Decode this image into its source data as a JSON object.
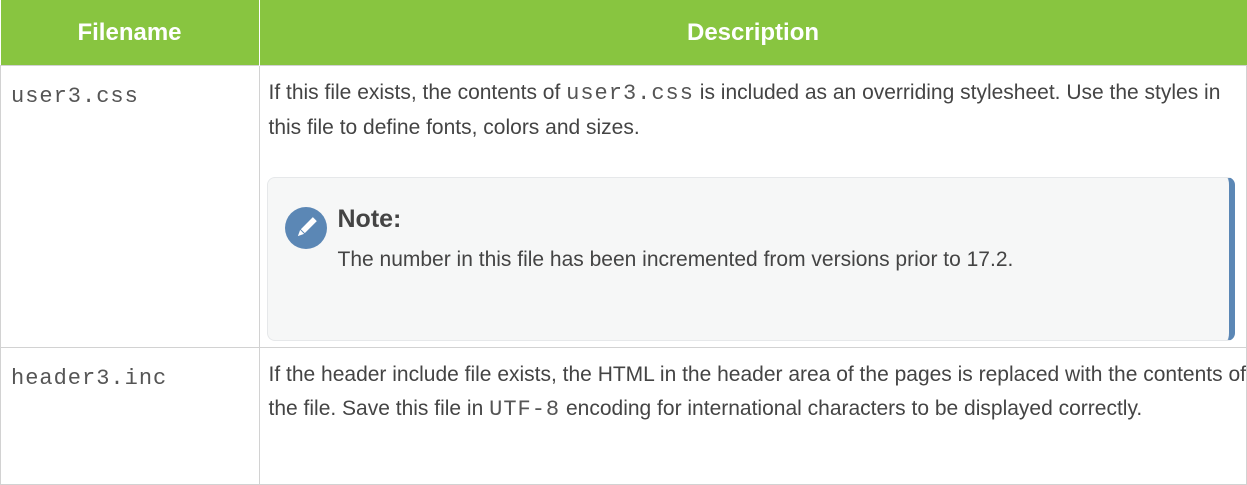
{
  "table": {
    "headers": {
      "filename": "Filename",
      "description": "Description"
    },
    "rows": [
      {
        "filename": "user3.css",
        "desc_part1": "If this file exists, the contents of ",
        "desc_code": "user3.css",
        "desc_part2": " is included as an overriding stylesheet. Use the styles in this file to define fonts, colors and sizes.",
        "note": {
          "icon": "pencil-icon",
          "title": "Note:",
          "body": "The number in this file has been incremented from versions prior to 17.2."
        }
      },
      {
        "filename": "header3.inc",
        "desc_part1": "If the header include file exists, the HTML in the header area of the pages is replaced with the contents of the file. Save this file in ",
        "desc_code": "UTF-8",
        "desc_part2": " encoding for international characters to be displayed correctly."
      }
    ]
  },
  "colors": {
    "header_bg": "#88c540",
    "note_accent": "#5b87b5",
    "note_bg": "#f6f7f7"
  }
}
